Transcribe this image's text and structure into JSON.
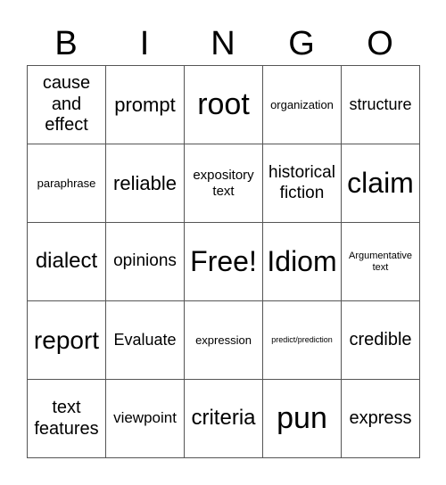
{
  "header": {
    "letters": [
      "B",
      "I",
      "N",
      "G",
      "O"
    ]
  },
  "board": {
    "rows": [
      [
        "cause and effect",
        "prompt",
        "root",
        "organization",
        "structure"
      ],
      [
        "paraphrase",
        "reliable",
        "expository text",
        "historical fiction",
        "claim"
      ],
      [
        "dialect",
        "opinions",
        "Free!",
        "Idiom",
        "Argumentative text"
      ],
      [
        "report",
        "Evaluate",
        "expression",
        "predict/prediction",
        "credible"
      ],
      [
        "text features",
        "viewpoint",
        "criteria",
        "pun",
        "express"
      ]
    ],
    "free_space": "Free!"
  }
}
